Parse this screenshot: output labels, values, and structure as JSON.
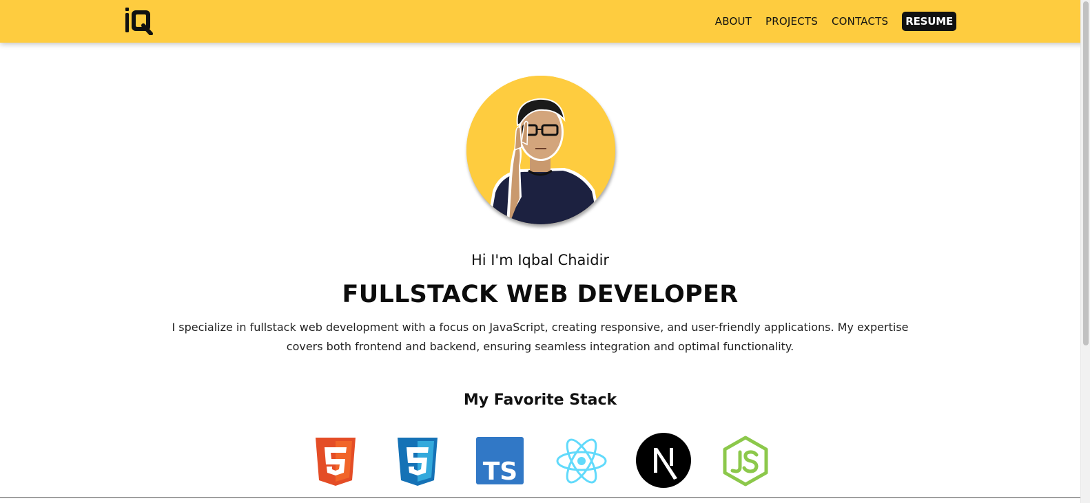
{
  "nav": {
    "logo_icon": "iq-logo-icon",
    "about": "ABOUT",
    "projects": "PROJECTS",
    "contacts": "CONTACTS",
    "resume": "RESUME"
  },
  "hero": {
    "avatar_icon": "profile-photo",
    "greeting": "Hi I'm Iqbal Chaidir",
    "headline": "FULLSTACK WEB DEVELOPER",
    "intro": "I specialize in fullstack web development with a focus on JavaScript, creating responsive, and user-friendly applications. My expertise covers both frontend and backend, ensuring seamless integration and optimal functionality."
  },
  "stack": {
    "title": "My Favorite Stack",
    "items": [
      {
        "icon": "html5-icon"
      },
      {
        "icon": "css3-icon"
      },
      {
        "icon": "typescript-icon"
      },
      {
        "icon": "react-icon"
      },
      {
        "icon": "nextjs-icon"
      },
      {
        "icon": "nodejs-icon"
      }
    ]
  },
  "colors": {
    "brand_yellow": "#FECC3F",
    "text_dark": "#111111",
    "html5_orange": "#E44D26",
    "css3_blue": "#1572B6",
    "ts_blue": "#3178C6",
    "react_cyan": "#61DAFB",
    "node_green": "#8CC84B"
  }
}
